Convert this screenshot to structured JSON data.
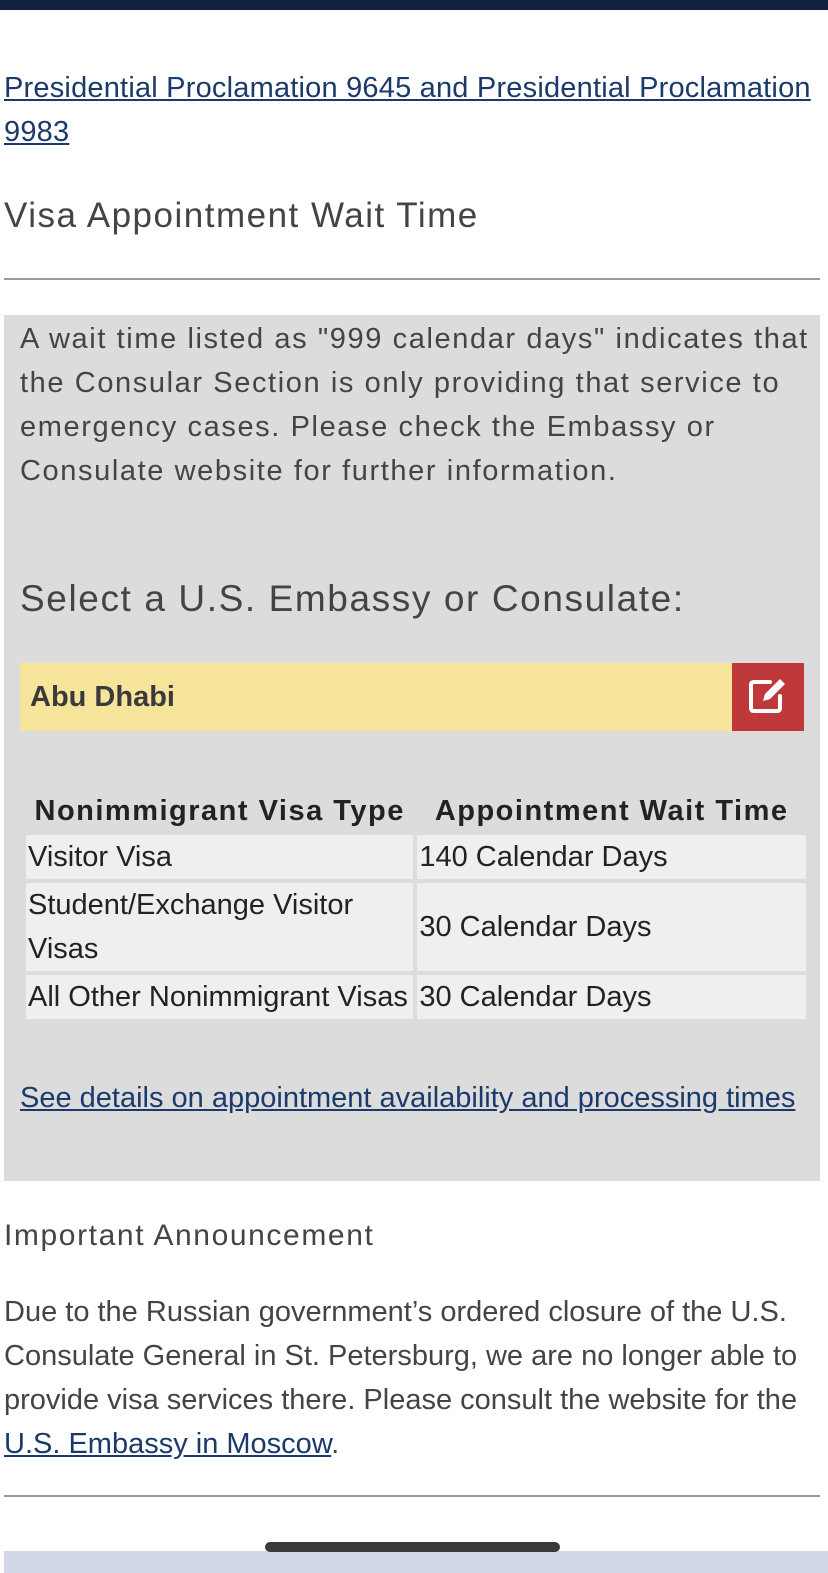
{
  "proclamation_link": "Presidential Proclamation 9645 and Presidential Proclamation 9983",
  "section_title": "Visa Appointment Wait Time",
  "panel": {
    "intro": "A wait time listed as \"999 calendar days\" indicates that the Consular Section is only providing that service to emergency cases.  Please check the Embassy or Consulate website for further information.",
    "select_title": "Select a U.S. Embassy or Consulate:",
    "selected_post": "Abu Dhabi",
    "edit_icon": "edit-icon",
    "table": {
      "headers": [
        "Nonimmigrant Visa Type",
        "Appointment Wait Time"
      ],
      "rows": [
        [
          "Visitor Visa",
          "140 Calendar Days"
        ],
        [
          "Student/Exchange Visitor Visas",
          "30 Calendar Days"
        ],
        [
          "All Other Nonimmigrant Visas",
          "30 Calendar Days"
        ]
      ]
    },
    "details_link": "See details on appointment availability and processing times"
  },
  "announcement": {
    "title": "Important Announcement",
    "body": "Due to the Russian government’s ordered closure of the U.S. Consulate General in St. Petersburg, we are no longer able to provide visa services there.  Please consult the website for the ",
    "link": "U.S. Embassy in Moscow",
    "end": "."
  },
  "colors": {
    "top_bar": "#13233f",
    "link": "#1b3a6b",
    "panel_bg": "#dcdcdc",
    "selector_bg": "#f6e49a",
    "edit_button": "#c0393a"
  }
}
